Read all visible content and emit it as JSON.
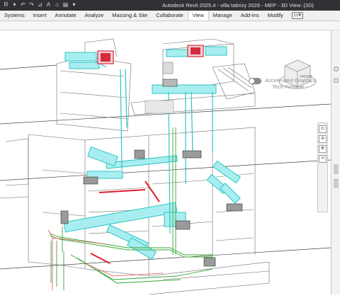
{
  "app": {
    "title": "Autodesk Revit 2025.4 - villa tabrizy 2026 - MEP - 3D View: {3D}"
  },
  "quick_access": [
    {
      "icon": "revit-logo-icon",
      "glyph": "R"
    },
    {
      "icon": "open-icon",
      "glyph": "▾"
    },
    {
      "icon": "undo-icon",
      "glyph": "↶"
    },
    {
      "icon": "redo-icon",
      "glyph": "↷"
    },
    {
      "icon": "measure-icon",
      "glyph": "⊿"
    },
    {
      "icon": "text-icon",
      "glyph": "A"
    },
    {
      "icon": "3d-view-icon",
      "glyph": "⌂"
    },
    {
      "icon": "switch-windows-icon",
      "glyph": "▤"
    },
    {
      "icon": "dropdown-icon",
      "glyph": "▾"
    }
  ],
  "ribbon": {
    "tabs": [
      "Systems",
      "Insert",
      "Annotate",
      "Analyze",
      "Massing & Site",
      "Collaborate",
      "View",
      "Manage",
      "Add-Ins",
      "Modify"
    ],
    "active_tab": "View"
  },
  "viewport": {
    "agp_line1": "Accelerated Graphics",
    "agp_line2": "Tech Preview",
    "viewcube_face": "FRONT"
  },
  "colors": {
    "duct": "#38d3d3",
    "duct_fill": "#a8eef0",
    "pipe_red": "#e0202a",
    "pipe_green": "#33a833",
    "linework": "#555555",
    "equipment": "#d62b3d"
  }
}
